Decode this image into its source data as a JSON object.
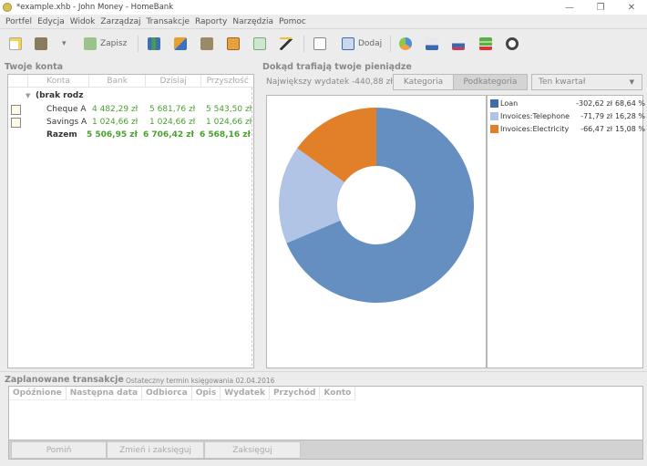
{
  "window": {
    "title": "*example.xhb - John Money - HomeBank",
    "minimize": "—",
    "restore": "❐",
    "close": "✕"
  },
  "menu": [
    "Portfel",
    "Edycja",
    "Widok",
    "Zarządzaj",
    "Transakcje",
    "Raporty",
    "Narzędzia",
    "Pomoc"
  ],
  "toolbar": {
    "save_label": "Zapisz",
    "add_label": "Dodaj"
  },
  "accounts": {
    "title": "Twoje konta",
    "columns": [
      "Konta",
      "Bank",
      "Dzisiaj",
      "Przyszłość"
    ],
    "group": "(brak rodz",
    "rows": [
      {
        "name": "Cheque A",
        "bank": "4 482,29 zł",
        "today": "5 681,76 zł",
        "future": "5 543,50 zł"
      },
      {
        "name": "Savings A",
        "bank": "1 024,66 zł",
        "today": "1 024,66 zł",
        "future": "1 024,66 zł"
      }
    ],
    "total": {
      "name": "Razem",
      "bank": "5 506,95 zł",
      "today": "6 706,42 zł",
      "future": "6 568,16 zł"
    }
  },
  "spending": {
    "title": "Dokąd trafiają twoje pieniądze",
    "largest_label": "Największy wydatek",
    "largest_value": "-440,88 zł",
    "tabs": [
      "Kategoria",
      "Podkategoria"
    ],
    "active_tab": "Podkategoria",
    "period": "Ten kwartał"
  },
  "chart_data": {
    "type": "pie",
    "donut": true,
    "categories": [
      "Loan",
      "Invoices:Telephone",
      "Invoices:Electricity"
    ],
    "values": [
      -302.62,
      -71.79,
      -66.47
    ],
    "amounts": [
      "-302,62 zł",
      "-71,79 zł",
      "-66,47 zł"
    ],
    "percents": [
      "68,64 %",
      "16,28 %",
      "15,08 %"
    ],
    "shares": [
      68.64,
      16.28,
      15.08
    ],
    "colors": [
      "#658fc1",
      "#b1c4e5",
      "#e2802a"
    ],
    "legend_swatches": [
      "#3e6ea8",
      "#b1c4e5",
      "#e2802a"
    ],
    "legend": "right"
  },
  "scheduled": {
    "title": "Zaplanowane transakcje",
    "subtitle": "Ostateczny termin księgowania",
    "date": "02.04.2016",
    "columns": [
      "Opóźnione",
      "Następna data",
      "Odbiorca",
      "Opis",
      "Wydatek",
      "Przychód",
      "Konto"
    ],
    "buttons": {
      "skip": "Pomiń",
      "edit_post": "Zmień i zaksięguj",
      "post": "Zaksięguj"
    }
  }
}
